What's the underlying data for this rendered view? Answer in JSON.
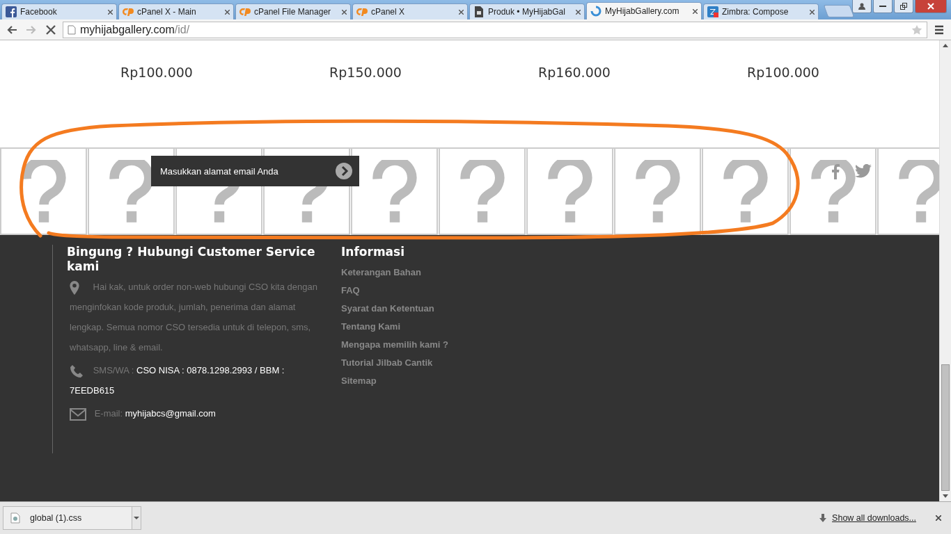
{
  "tabs": [
    {
      "title": "Facebook",
      "selected": false
    },
    {
      "title": "cPanel X - Main",
      "selected": false
    },
    {
      "title": "cPanel File Manager",
      "selected": false
    },
    {
      "title": "cPanel X",
      "selected": false
    },
    {
      "title": "Produk • MyHijabGal",
      "selected": false
    },
    {
      "title": "MyHijabGallery.com",
      "selected": true
    },
    {
      "title": "Zimbra: Compose",
      "selected": false
    }
  ],
  "address_bar": {
    "domain": "myhijabgallery.com",
    "path": "/id/"
  },
  "products": [
    {
      "price": "Rp100.000"
    },
    {
      "price": "Rp150.000"
    },
    {
      "price": "Rp160.000"
    },
    {
      "price": "Rp100.000"
    }
  ],
  "broken_images": [
    {
      "kind": "broken-image"
    },
    {
      "kind": "broken-image"
    },
    {
      "kind": "broken-image"
    },
    {
      "kind": "broken-image"
    },
    {
      "kind": "broken-image"
    },
    {
      "kind": "broken-image"
    },
    {
      "kind": "broken-image"
    },
    {
      "kind": "broken-image"
    },
    {
      "kind": "broken-image"
    },
    {
      "kind": "broken-image"
    },
    {
      "kind": "broken-image"
    }
  ],
  "newsletter": {
    "placeholder": "Masukkan alamat email Anda"
  },
  "contact": {
    "heading": "Bingung ? Hubungi Customer Service kami",
    "address": "Hai kak, untuk order non-web hubungi CSO kita dengan menginfokan kode produk, jumlah, penerima dan alamat lengkap. Semua nomor CSO tersedia untuk di telepon, sms, whatsapp, line & email.",
    "phone_label": "SMS/WA :",
    "phone": "CSO NISA : 0878.1298.2993 / BBM : 7EEDB615",
    "email_label": "E-mail:",
    "email": "myhijabcs@gmail.com"
  },
  "info": {
    "heading": "Informasi",
    "links": [
      "Keterangan Bahan",
      "FAQ",
      "Syarat dan Ketentuan",
      "Tentang Kami",
      "Mengapa memilih kami ?",
      "Tutorial Jilbab Cantik",
      "Sitemap"
    ]
  },
  "download_bar": {
    "file": "global (1).css",
    "show_all": "Show all downloads..."
  }
}
